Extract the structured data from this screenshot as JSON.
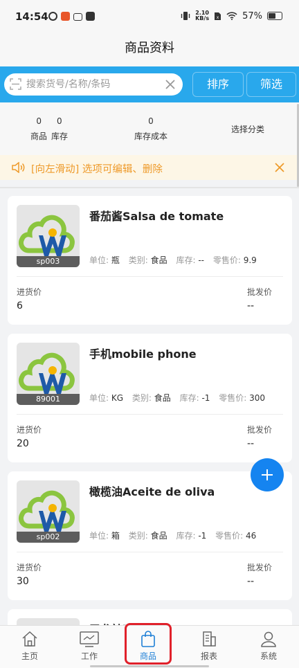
{
  "status_bar": {
    "time": "14:54",
    "net_speed_value": "2.10",
    "net_speed_unit": "KB/s",
    "battery": "57%"
  },
  "header": {
    "title": "商品资料"
  },
  "search": {
    "placeholder": "搜索货号/名称/条码",
    "sort_label": "排序",
    "filter_label": "筛选"
  },
  "summary": {
    "product_count": "0",
    "stock_count": "0",
    "product_label": "商品",
    "stock_label": "库存",
    "cost_value": "0",
    "cost_label": "库存成本",
    "category_label": "选择分类"
  },
  "notice": {
    "text": "[向左滑动] 选项可编辑、删除"
  },
  "products": [
    {
      "name": "番茄酱Salsa de tomate",
      "code": "sp003",
      "unit_label": "单位:",
      "unit": "瓶",
      "category_label": "类别:",
      "category": "食品",
      "stock_label": "库存:",
      "stock": "--",
      "retail_label": "零售价:",
      "retail": "9.9",
      "purchase_label": "进货价",
      "purchase": "6",
      "wholesale_label": "批发价",
      "wholesale": "--"
    },
    {
      "name": "手机mobile phone",
      "code": "89001",
      "unit_label": "单位:",
      "unit": "KG",
      "category_label": "类别:",
      "category": "食品",
      "stock_label": "库存:",
      "stock": "-1",
      "retail_label": "零售价:",
      "retail": "300",
      "purchase_label": "进货价",
      "purchase": "20",
      "wholesale_label": "批发价",
      "wholesale": "--"
    },
    {
      "name": "橄榄油Aceite de oliva",
      "code": "sp002",
      "unit_label": "单位:",
      "unit": "箱",
      "category_label": "类别:",
      "category": "食品",
      "stock_label": "库存:",
      "stock": "-1",
      "retail_label": "零售价:",
      "retail": "46",
      "purchase_label": "进货价",
      "purchase": "30",
      "wholesale_label": "批发价",
      "wholesale": "--"
    },
    {
      "name": "卫龙辣嘴Wei Long co boca y",
      "code": ""
    }
  ],
  "tabbar": {
    "home": "主页",
    "work": "工作",
    "goods": "商品",
    "report": "报表",
    "system": "系统"
  },
  "colors": {
    "accent": "#29a8ec",
    "notice_text": "#ee9a2a",
    "fab": "#1584f0",
    "tab_active": "#1e7fd6",
    "highlight": "#e0202a"
  }
}
